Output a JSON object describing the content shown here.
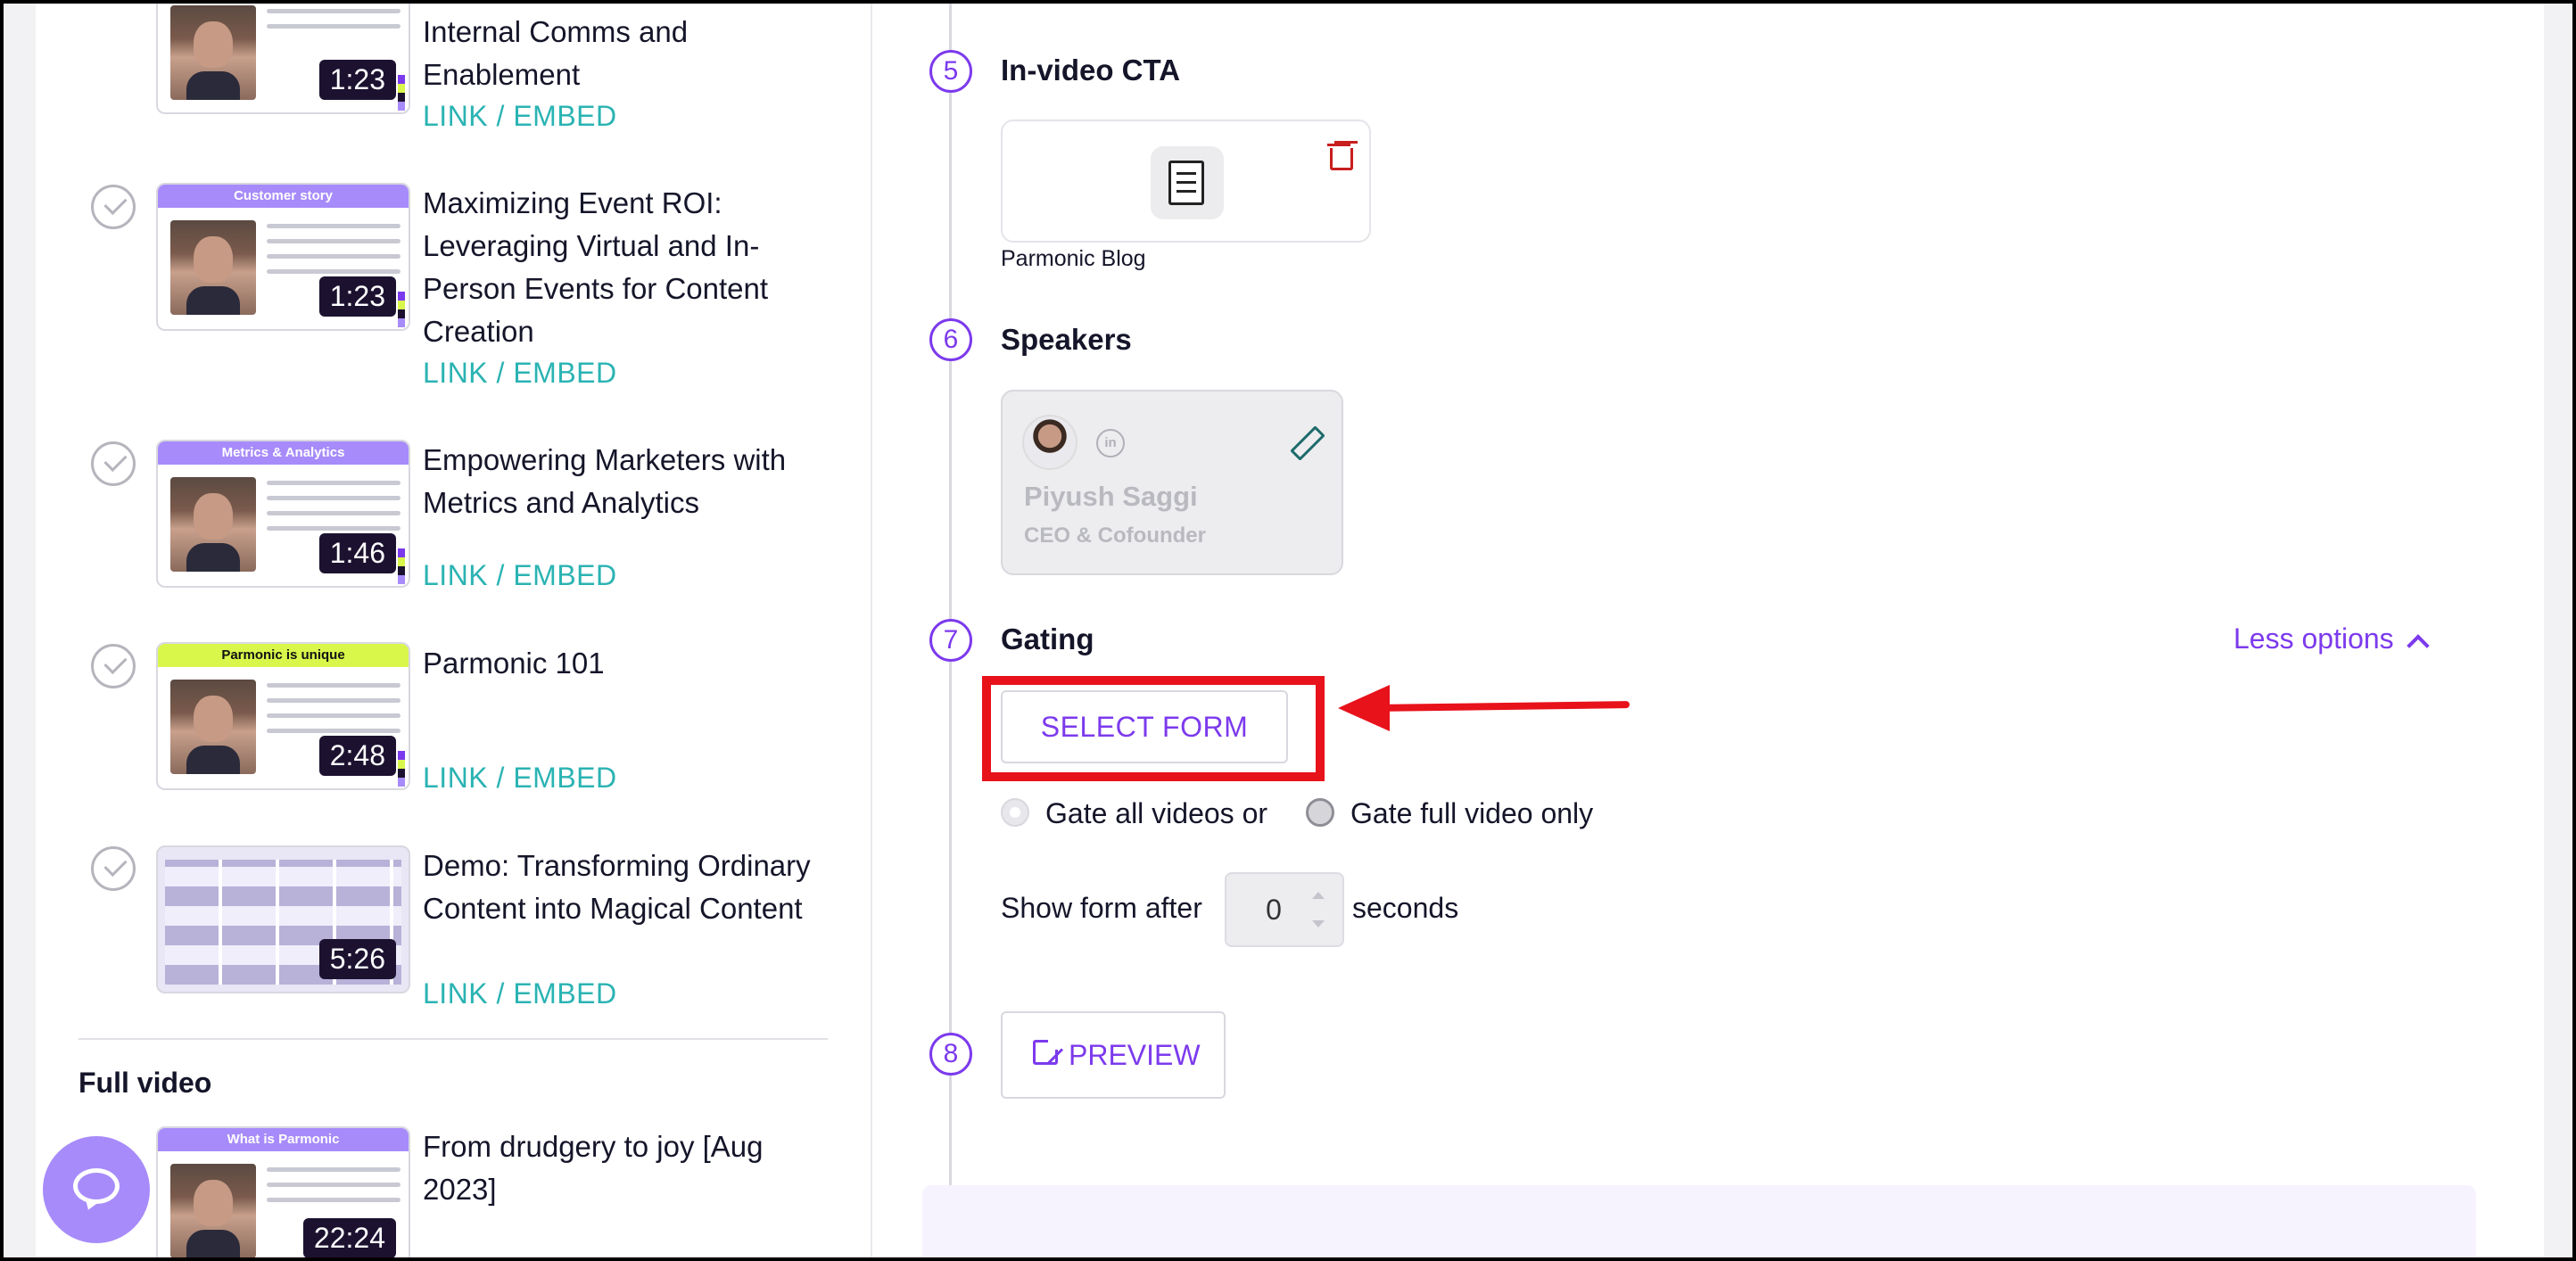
{
  "videos": [
    {
      "banner": "",
      "duration": "1:23",
      "title": "Internal Comms and Enablement",
      "link": "LINK / EMBED"
    },
    {
      "banner": "Customer story",
      "duration": "1:23",
      "title": "Maximizing Event ROI: Leveraging Virtual and In-Person Events for Content Creation",
      "link": "LINK / EMBED"
    },
    {
      "banner": "Metrics & Analytics",
      "duration": "1:46",
      "title": "Empowering Marketers with Metrics and Analytics",
      "link": "LINK / EMBED"
    },
    {
      "banner": "Parmonic is unique",
      "duration": "2:48",
      "title": "Parmonic 101",
      "link": "LINK / EMBED"
    },
    {
      "banner": "",
      "duration": "5:26",
      "title": "Demo: Transforming Ordinary Content into Magical Content",
      "link": "LINK / EMBED"
    }
  ],
  "full_video": {
    "section_label": "Full video",
    "banner": "What is Parmonic",
    "duration": "22:24",
    "title": "From drudgery to joy [Aug 2023]"
  },
  "steps": {
    "cta": {
      "number": "5",
      "title": "In-video CTA",
      "item_name": "Parmonic Blog"
    },
    "speakers": {
      "number": "6",
      "title": "Speakers",
      "name": "Piyush Saggi",
      "role": "CEO & Cofounder",
      "linkedin": "in"
    },
    "gating": {
      "number": "7",
      "title": "Gating",
      "less_options": "Less options",
      "select_form": "SELECT FORM",
      "radio_all": "Gate all videos or",
      "radio_full": "Gate full video only",
      "show_form_after": "Show form after",
      "seconds_value": "0",
      "seconds_label": "seconds"
    },
    "preview": {
      "number": "8",
      "label": "PREVIEW"
    }
  },
  "colors": {
    "accent": "#7c3aed",
    "link": "#2bb3b3",
    "annotation": "#e8121b"
  },
  "icons": {
    "check": "check-circle-icon",
    "trash": "trash-icon",
    "pencil": "pencil-icon",
    "chat": "chat-bubble-icon",
    "external": "external-link-icon",
    "chevron": "chevron-up-icon"
  }
}
